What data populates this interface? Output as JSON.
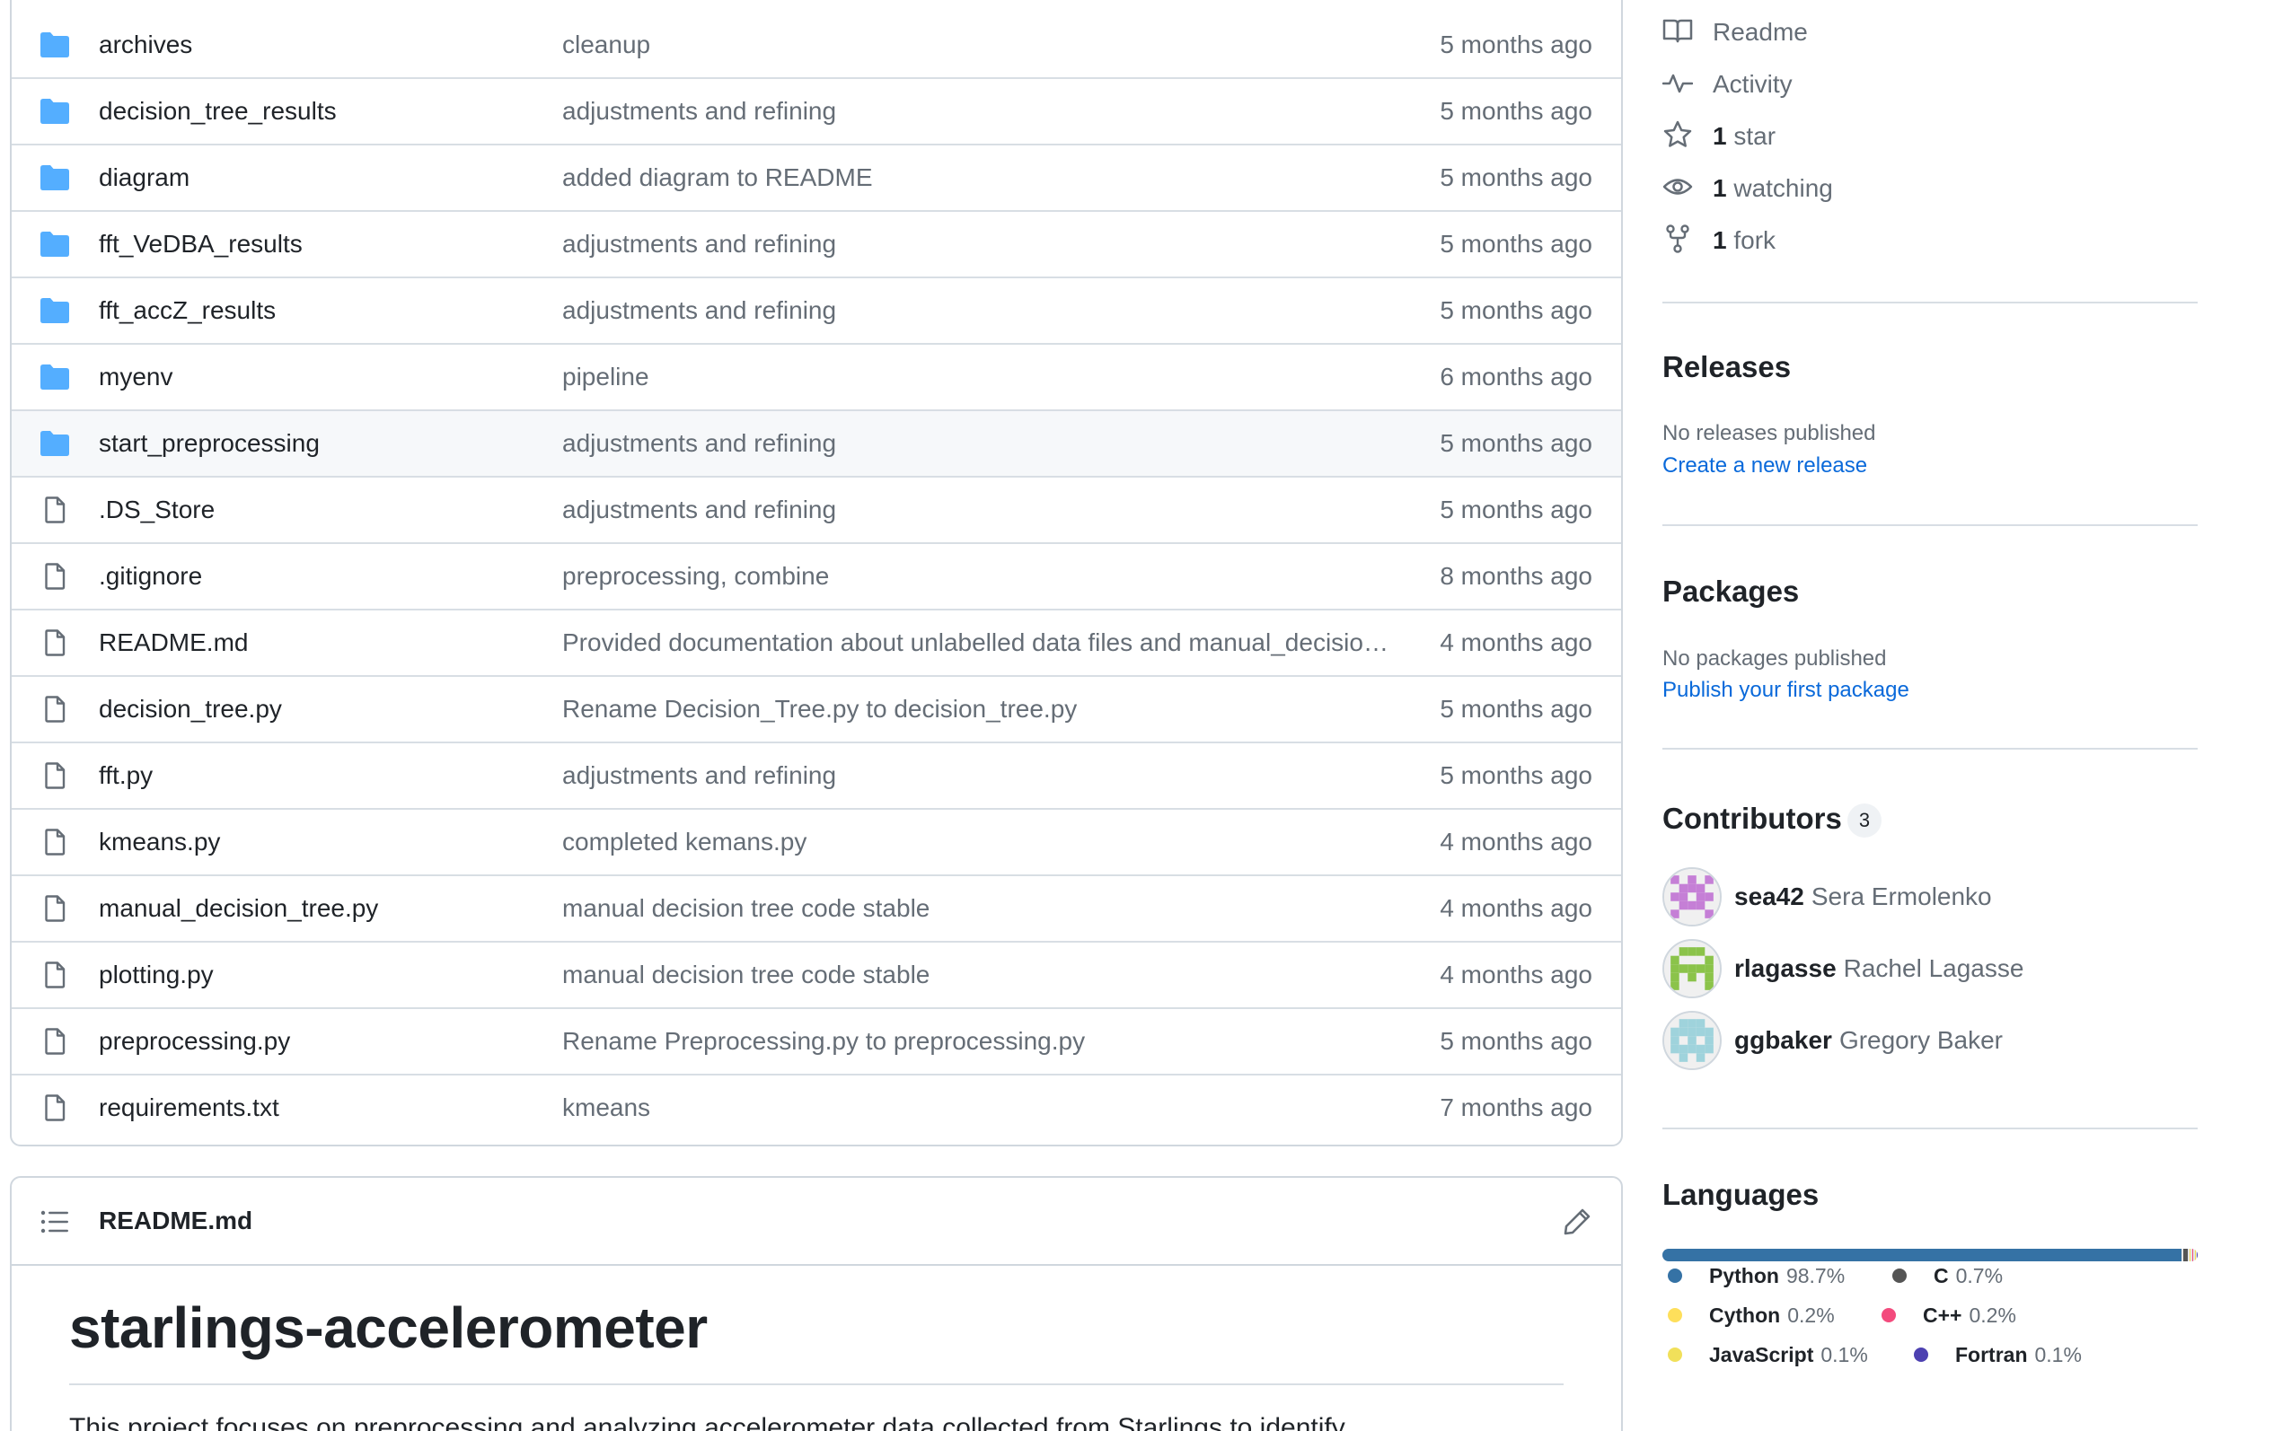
{
  "files": [
    {
      "type": "dir",
      "name": "archives",
      "message": "cleanup",
      "date": "5 months ago"
    },
    {
      "type": "dir",
      "name": "decision_tree_results",
      "message": "adjustments and refining",
      "date": "5 months ago"
    },
    {
      "type": "dir",
      "name": "diagram",
      "message": "added diagram to README",
      "date": "5 months ago"
    },
    {
      "type": "dir",
      "name": "fft_VeDBA_results",
      "message": "adjustments and refining",
      "date": "5 months ago"
    },
    {
      "type": "dir",
      "name": "fft_accZ_results",
      "message": "adjustments and refining",
      "date": "5 months ago"
    },
    {
      "type": "dir",
      "name": "myenv",
      "message": "pipeline",
      "date": "6 months ago"
    },
    {
      "type": "dir",
      "name": "start_preprocessing",
      "message": "adjustments and refining",
      "date": "5 months ago",
      "highlighted": true
    },
    {
      "type": "file",
      "name": ".DS_Store",
      "message": "adjustments and refining",
      "date": "5 months ago"
    },
    {
      "type": "file",
      "name": ".gitignore",
      "message": "preprocessing, combine",
      "date": "8 months ago"
    },
    {
      "type": "file",
      "name": "README.md",
      "message": "Provided documentation about unlabelled data files and manual_decision_tree.py",
      "date": "4 months ago"
    },
    {
      "type": "file",
      "name": "decision_tree.py",
      "message": "Rename Decision_Tree.py to decision_tree.py",
      "date": "5 months ago"
    },
    {
      "type": "file",
      "name": "fft.py",
      "message": "adjustments and refining",
      "date": "5 months ago"
    },
    {
      "type": "file",
      "name": "kmeans.py",
      "message": "completed kemans.py",
      "date": "4 months ago"
    },
    {
      "type": "file",
      "name": "manual_decision_tree.py",
      "message": "manual decision tree code stable",
      "date": "4 months ago"
    },
    {
      "type": "file",
      "name": "plotting.py",
      "message": "manual decision tree code stable",
      "date": "4 months ago"
    },
    {
      "type": "file",
      "name": "preprocessing.py",
      "message": "Rename Preprocessing.py to preprocessing.py",
      "date": "5 months ago"
    },
    {
      "type": "file",
      "name": "requirements.txt",
      "message": "kmeans",
      "date": "7 months ago"
    }
  ],
  "readme": {
    "filename": "README.md",
    "title": "starlings-accelerometer",
    "intro": "This project focuses on preprocessing and analyzing accelerometer data collected from Starlings to identify"
  },
  "sidebar": {
    "meta": [
      {
        "icon": "book-icon",
        "count": "",
        "label": "Readme"
      },
      {
        "icon": "pulse-icon",
        "count": "",
        "label": "Activity"
      },
      {
        "icon": "star-icon",
        "count": "1",
        "label": " star"
      },
      {
        "icon": "eye-icon",
        "count": "1",
        "label": " watching"
      },
      {
        "icon": "fork-icon",
        "count": "1",
        "label": " fork"
      }
    ],
    "releases": {
      "heading": "Releases",
      "empty": "No releases published",
      "link": "Create a new release"
    },
    "packages": {
      "heading": "Packages",
      "empty": "No packages published",
      "link": "Publish your first package"
    },
    "contributors": {
      "heading": "Contributors",
      "count": "3",
      "people": [
        {
          "login": "sea42",
          "name": "Sera Ermolenko",
          "color": "#c57fd6"
        },
        {
          "login": "rlagasse",
          "name": "Rachel Lagasse",
          "color": "#8bc34a"
        },
        {
          "login": "ggbaker",
          "name": "Gregory Baker",
          "color": "#9fd3dc"
        }
      ]
    },
    "languages": {
      "heading": "Languages",
      "items": [
        {
          "name": "Python",
          "pct": "98.7%",
          "value": 98.7,
          "color": "#3572A5"
        },
        {
          "name": "C",
          "pct": "0.7%",
          "value": 0.7,
          "color": "#555555"
        },
        {
          "name": "Cython",
          "pct": "0.2%",
          "value": 0.2,
          "color": "#fedf5b"
        },
        {
          "name": "C++",
          "pct": "0.2%",
          "value": 0.2,
          "color": "#f34b7d"
        },
        {
          "name": "JavaScript",
          "pct": "0.1%",
          "value": 0.1,
          "color": "#f1e05a"
        },
        {
          "name": "Fortran",
          "pct": "0.1%",
          "value": 0.1,
          "color": "#4d41b1"
        }
      ]
    }
  }
}
